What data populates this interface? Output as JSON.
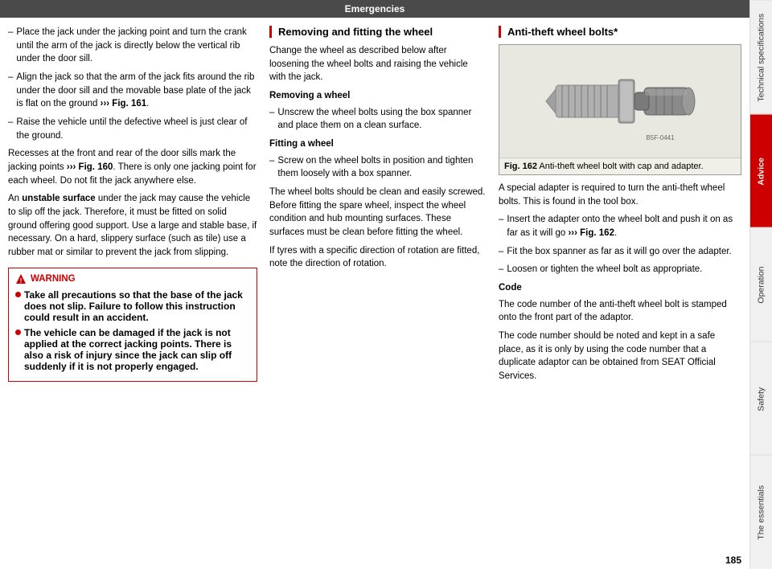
{
  "header": {
    "title": "Emergencies"
  },
  "page_number": "185",
  "sidebar": {
    "tabs": [
      {
        "id": "technical",
        "label": "Technical specifications",
        "active": false
      },
      {
        "id": "advice",
        "label": "Advice",
        "active": true
      },
      {
        "id": "operation",
        "label": "Operation",
        "active": false
      },
      {
        "id": "safety",
        "label": "Safety",
        "active": false
      },
      {
        "id": "essentials",
        "label": "The essentials",
        "active": false
      }
    ]
  },
  "left_column": {
    "bullets": [
      "Place the jack under the jacking point and turn the crank until the arm of the jack is directly below the vertical rib under the door sill.",
      "Align the jack so that the arm of the jack fits around the rib under the door sill and the movable base plate of the jack is flat on the ground \\u203a\\u203a\\u203a Fig. 161.",
      "Raise the vehicle until the defective wheel is just clear of the ground."
    ],
    "paragraph1": "Recesses at the front and rear of the door sills mark the jacking points ››› Fig. 160. There is only one jacking point for each wheel. Do not fit the jack anywhere else.",
    "paragraph2_prefix": "An ",
    "paragraph2_bold": "unstable surface",
    "paragraph2_suffix": " under the jack may cause the vehicle to slip off the jack. Therefore, it must be fitted on solid ground offering good support. Use a large and stable base, if necessary. On a hard, slippery surface (such as tile) use a rubber mat or similar to prevent the jack from slipping.",
    "warning": {
      "title": "WARNING",
      "bullets": [
        "Take all precautions so that the base of the jack does not slip. Failure to follow this instruction could result in an accident.",
        "The vehicle can be damaged if the jack is not applied at the correct jacking points. There is also a risk of injury since the jack can slip off suddenly if it is not properly engaged."
      ]
    }
  },
  "middle_column": {
    "section_title": "Removing and fitting the wheel",
    "intro": "Change the wheel as described below after loosening the wheel bolts and raising the vehicle with the jack.",
    "removing_heading": "Removing a wheel",
    "removing_bullet": "Unscrew the wheel bolts using the box spanner and place them on a clean surface.",
    "fitting_heading": "Fitting a wheel",
    "fitting_bullet": "Screw on the wheel bolts in position and tighten them loosely with a box spanner.",
    "paragraph1": "The wheel bolts should be clean and easily screwed. Before fitting the spare wheel, inspect the wheel condition and hub mounting surfaces. These surfaces must be clean before fitting the wheel.",
    "paragraph2": "If tyres with a specific direction of rotation are fitted, note the direction of rotation."
  },
  "right_column": {
    "section_title": "Anti-theft wheel bolts*",
    "figure": {
      "ref": "Fig. 162",
      "caption": "Anti-theft wheel bolt with cap and adapter.",
      "img_ref": "B5F-0441"
    },
    "intro": "A special adapter is required to turn the anti-theft wheel bolts. This is found in the tool box.",
    "bullets": [
      "Insert the adapter onto the wheel bolt and push it on as far as it will go ››› Fig. 162.",
      "Fit the box spanner as far as it will go over the adapter.",
      "Loosen or tighten the wheel bolt as appropriate."
    ],
    "code_heading": "Code",
    "code_paragraph1": "The code number of the anti-theft wheel bolt is stamped onto the front part of the adaptor.",
    "code_paragraph2": "The code number should be noted and kept in a safe place, as it is only by using the code number that a duplicate adaptor can be obtained from SEAT Official Services."
  }
}
